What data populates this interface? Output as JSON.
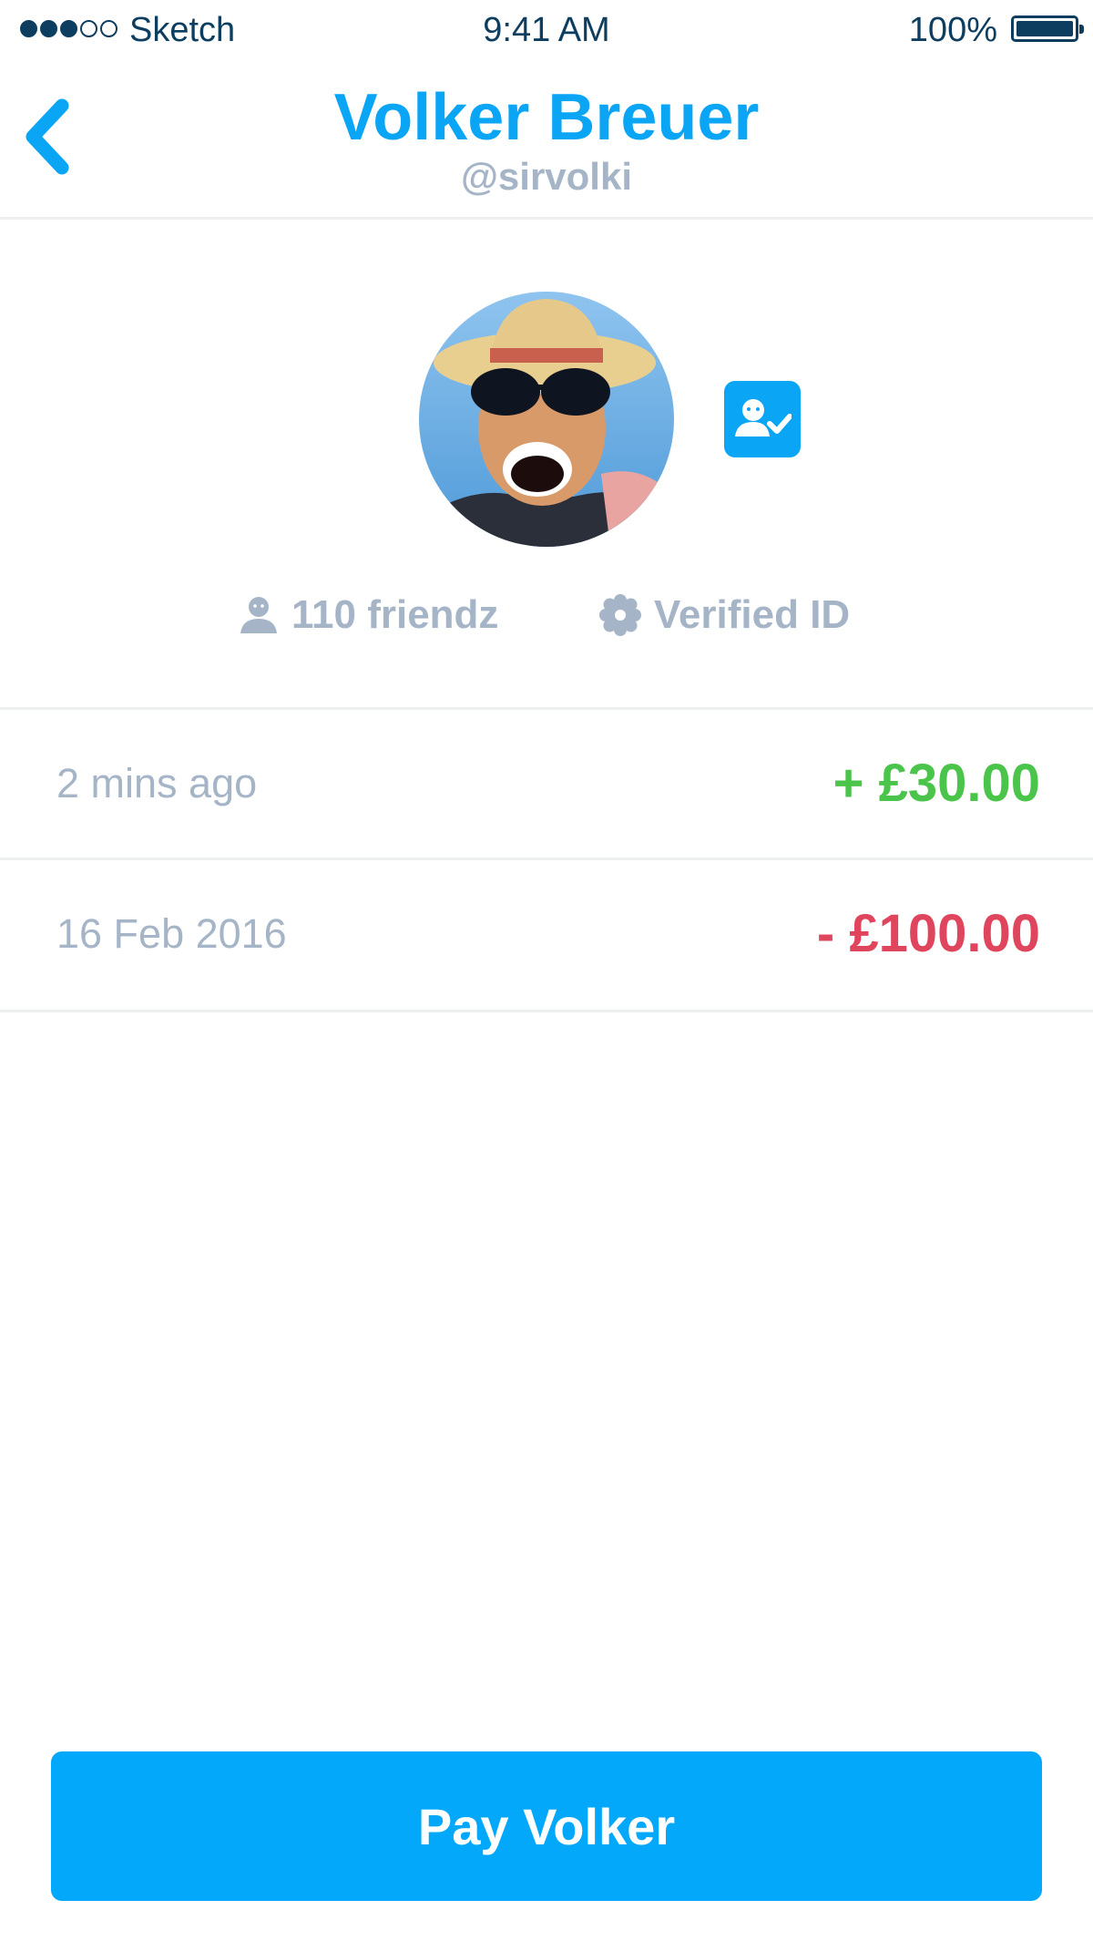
{
  "status_bar": {
    "signal_strength": "3 of 5",
    "carrier": "Sketch",
    "time": "9:41 AM",
    "battery": "100%",
    "battery_level": 1.0
  },
  "header": {
    "back_icon": "chevron-left-icon",
    "title": "Volker Breuer",
    "handle": "@sirvolki"
  },
  "profile": {
    "avatar": "profile-photo",
    "verify_icon": "user-check-icon",
    "friends_icon": "person-icon",
    "friends_label": "110 friendz",
    "verified_icon": "badge-gear-icon",
    "verified_label": "Verified ID"
  },
  "transactions": [
    {
      "date": "2 mins ago",
      "amount": "+ £30.00",
      "direction": "incoming"
    },
    {
      "date": "16 Feb 2016",
      "amount": "- £100.00",
      "direction": "outgoing"
    }
  ],
  "pay_button": {
    "label": "Pay Volker"
  },
  "colors": {
    "accent": "#0aa5f5",
    "status_text": "#0d3d5f",
    "muted": "#a5b5c7",
    "positive": "#4bc44c",
    "negative": "#e0455e",
    "button": "#03a8fb"
  }
}
